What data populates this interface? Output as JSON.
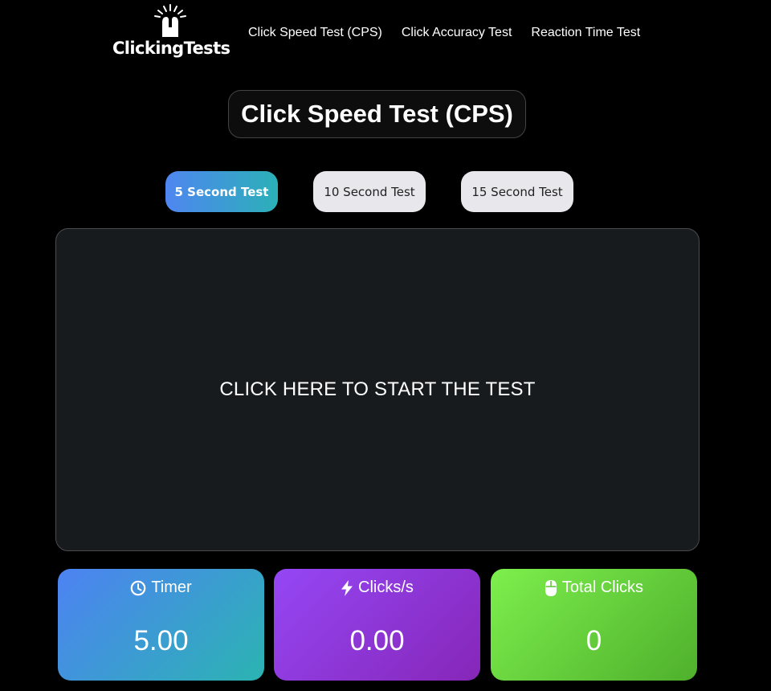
{
  "brand": {
    "name": "ClickingTests"
  },
  "nav": [
    {
      "label": "Click Speed Test (CPS)"
    },
    {
      "label": "Click Accuracy Test"
    },
    {
      "label": "Reaction Time Test"
    }
  ],
  "page_title": "Click Speed Test (CPS)",
  "modes": [
    {
      "label": "5 Second Test",
      "active": true
    },
    {
      "label": "10 Second Test",
      "active": false
    },
    {
      "label": "15 Second Test",
      "active": false
    }
  ],
  "click_area": {
    "prompt": "CLICK HERE TO START THE TEST"
  },
  "stats": {
    "timer": {
      "label": "Timer",
      "value": "5.00",
      "icon": "clock-icon"
    },
    "cps": {
      "label": "Clicks/s",
      "value": "0.00",
      "icon": "lightning-icon"
    },
    "total": {
      "label": "Total Clicks",
      "value": "0",
      "icon": "mouse-icon"
    }
  },
  "colors": {
    "background": "#000000",
    "active_mode_gradient": [
      "#4f86f0",
      "#2bb0b8"
    ],
    "timer_card": [
      "#4d82f3",
      "#2bb4b2"
    ],
    "cps_card": [
      "#9547f5",
      "#8626b8"
    ],
    "total_card": [
      "#7def4d",
      "#4fb02c"
    ]
  }
}
